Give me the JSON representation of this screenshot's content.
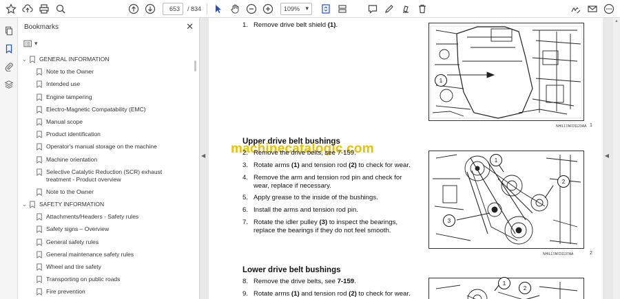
{
  "toolbar": {
    "page_current": "653",
    "page_total": "/ 834",
    "zoom": "109%"
  },
  "bookmarks": {
    "title": "Bookmarks",
    "sections": [
      {
        "label": "GENERAL INFORMATION",
        "items": [
          "Note to the Owner",
          "Intended use",
          "Engine tampering",
          "Electro-Magnetic Compatability (EMC)",
          "Manual scope",
          "Product identification",
          "Operator's manual storage on the machine",
          "Machine orientation",
          "Selective Catalytic Reduction (SCR) exhaust treatment - Product overview",
          "Note to the Owner"
        ]
      },
      {
        "label": "SAFETY INFORMATION",
        "items": [
          "Attachments/Headers - Safety rules",
          "Safety signs  – Overview",
          "General safety rules",
          "General maintenance safety rules",
          "Wheel and tire safety",
          "Transporting on public roads",
          "Fire prevention"
        ]
      }
    ]
  },
  "document": {
    "step1": {
      "num": "1.",
      "pre": "Remove drive belt shield ",
      "bold": "(1)",
      "post": "."
    },
    "upper_title": "Upper drive belt bushings",
    "watermark": "machinecatalogic.com",
    "upper_steps": [
      {
        "num": "2.",
        "text": "Remove the drive belts, see 7-159."
      },
      {
        "num": "3.",
        "pre": "Rotate arms ",
        "b1": "(1)",
        "mid": " and tension rod ",
        "b2": "(2)",
        "post": " to check for wear."
      },
      {
        "num": "4.",
        "text": "Remove the arm and tension rod pin and check for wear, replace if necessary."
      },
      {
        "num": "5.",
        "text": "Apply grease to the inside of the bushings."
      },
      {
        "num": "6.",
        "text": "Install the arms and tension rod pin."
      },
      {
        "num": "7.",
        "pre": "Rotate the idler pulley ",
        "b1": "(3)",
        "post": " to inspect the bearings, replace the bearings if they do not feel smooth."
      }
    ],
    "lower_title": "Lower drive belt bushings",
    "lower_steps": [
      {
        "num": "8.",
        "pre": "Remove the drive belts, see ",
        "b1": "7-159",
        "post": "."
      },
      {
        "num": "9.",
        "pre": "Rotate arms ",
        "b1": "(1)",
        "mid": " and tension rod ",
        "b2": "(2)",
        "post": " to check for wear."
      }
    ],
    "fig1": {
      "caption": "NHIL17AFD1123AA",
      "number": "1",
      "callout": "1"
    },
    "fig2": {
      "caption": "NHIL17AFD1137AA",
      "number": "2",
      "callouts": [
        "1",
        "2",
        "3"
      ]
    },
    "fig3": {
      "callouts": [
        "1",
        "2"
      ]
    }
  }
}
